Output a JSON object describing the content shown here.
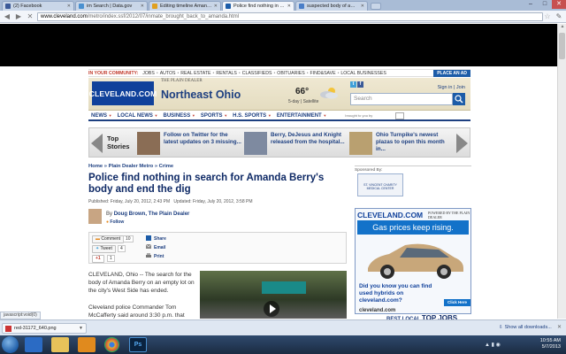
{
  "browser": {
    "tabs": [
      {
        "label": "(2) Facebook",
        "favicon_color": "#3b5998",
        "active": false
      },
      {
        "label": "im Search | Data.gov",
        "favicon_color": "#4a90d0",
        "active": false
      },
      {
        "label": "Editing timeline Amanda",
        "favicon_color": "#e0a020",
        "active": false
      },
      {
        "label": "Police find nothing in sea",
        "favicon_color": "#1c5ca8",
        "active": true
      },
      {
        "label": "suspected body of amanda",
        "favicon_color": "#4a7ec8",
        "active": false
      }
    ],
    "url_host": "www.cleveland.com",
    "url_path": "/metro/index.ssf/2012/07/inmate_brought_back_to_amanda.html"
  },
  "community_bar": {
    "label": "IN YOUR COMMUNITY:",
    "items": [
      "JOBS",
      "AUTOS",
      "REAL ESTATE",
      "RENTALS",
      "CLASSIFIEDS",
      "OBITUARIES",
      "FIND&SAVE",
      "LOCAL BUSINESSES"
    ],
    "place_ad": "PLACE AN AD"
  },
  "header": {
    "logo": "CLEVELAND.COM",
    "plain_dealer": "THE PLAIN DEALER",
    "region": "Northeast Ohio",
    "temperature": "66°",
    "forecast": "5-day | Satellite",
    "signin": "Sign in | Join",
    "search_placeholder": "Search"
  },
  "section_nav": {
    "items": [
      "NEWS",
      "LOCAL NEWS",
      "BUSINESS",
      "SPORTS",
      "H.S. SPORTS",
      "ENTERTAINMENT"
    ],
    "brought_by": "brought to you by"
  },
  "top_stories": {
    "title": "Top Stories",
    "items": [
      {
        "text": "Follow on Twitter for the latest updates on 3 missing...",
        "thumb_color": "#8a6d55"
      },
      {
        "text": "Berry, DeJesus and Knight released from the hospital...",
        "thumb_color": "#7e8aa0"
      },
      {
        "text": "Ohio Turnpike's newest plazas to open this month in...",
        "thumb_color": "#b9a070"
      }
    ]
  },
  "article": {
    "breadcrumb": [
      "Home",
      "Plain Dealer Metro",
      "Crime"
    ],
    "breadcrumb_sep": "»",
    "headline": "Police find nothing in search for Amanda Berry's body and end the dig",
    "published": "Published: Friday, July 20, 2012, 2:43 PM",
    "updated": "Updated: Friday, July 20, 2012, 3:58 PM",
    "by": "By",
    "author": "Doug Brown, The Plain Dealer",
    "follow": "Follow",
    "share": {
      "comment_label": "Comment",
      "comment_count": "10",
      "tweet_label": "Tweet",
      "tweet_count": "4",
      "gplus_label": "+1",
      "gplus_count": "1",
      "share_link": "Share",
      "email_link": "Email",
      "print_link": "Print"
    },
    "paragraph1": "CLEVELAND, Ohio -- The search for the body of Amanda Berry on an empty lot on the city's West Side has ended.",
    "paragraph2": "Cleveland police Commander Tom McCafferty said around 3:30 p.m. that"
  },
  "sidebar": {
    "sponsored_by": "Sponsored By:",
    "sponsor_name": "ST. VINCENT CHARITY MEDICAL CENTER",
    "ad": {
      "logo": "CLEVELAND.COM",
      "pd": "POWERED BY THE PLAIN DEALER",
      "headline": "Gas prices keep rising.",
      "text": "Did you know you can find used hybrids on cleveland.com?",
      "click": "Click Here",
      "url": "cleveland.com"
    },
    "best_local": "BEST LOCAL",
    "top_jobs": "TOP JOBS"
  },
  "status_text": "javascript:void(0)",
  "downloads": {
    "file": "red-31172_640.png",
    "show_all": "Show all downloads..."
  },
  "taskbar": {
    "ps_label": "Ps",
    "time": "10:55 AM",
    "date": "5/7/2013"
  }
}
